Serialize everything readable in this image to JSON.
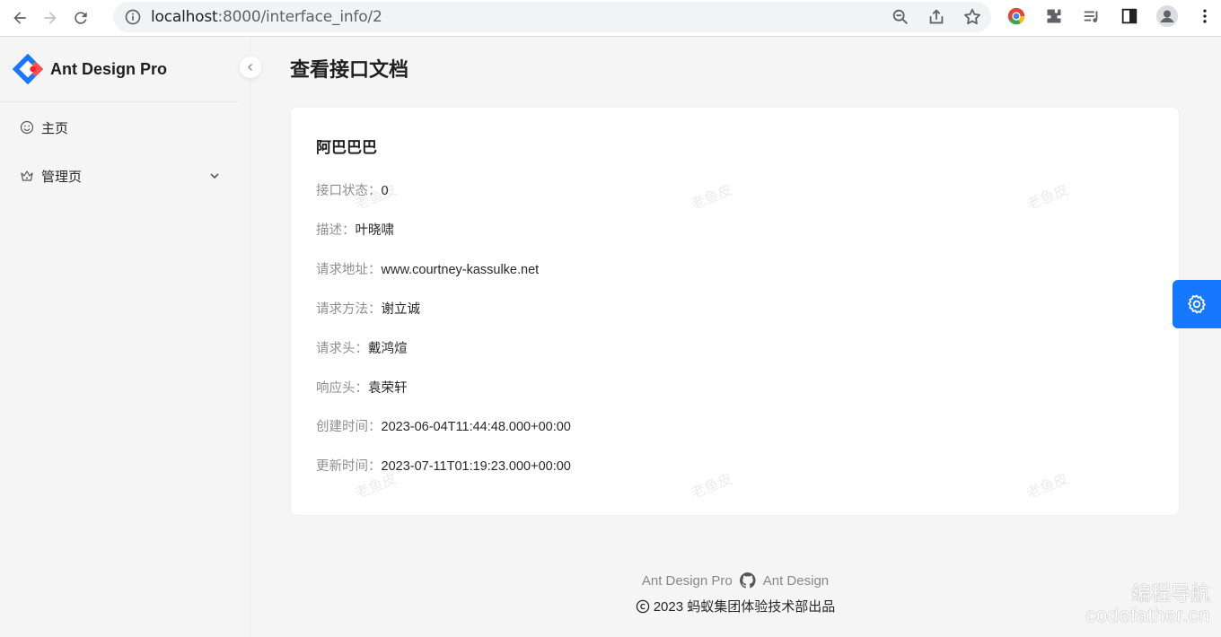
{
  "browser": {
    "url_host": "localhost",
    "url_path": ":8000/interface_info/2"
  },
  "sidebar": {
    "app_title": "Ant Design Pro",
    "items": [
      {
        "label": "主页",
        "icon": "smile-icon"
      },
      {
        "label": "管理页",
        "icon": "crown-icon"
      }
    ]
  },
  "page": {
    "title": "查看接口文档"
  },
  "card": {
    "name": "阿巴巴巴",
    "fields": [
      {
        "label": "接口状态：",
        "value": "0"
      },
      {
        "label": "描述：",
        "value": "叶晓啸"
      },
      {
        "label": "请求地址：",
        "value": "www.courtney-kassulke.net"
      },
      {
        "label": "请求方法：",
        "value": "谢立诚"
      },
      {
        "label": "请求头：",
        "value": "戴鸿煊"
      },
      {
        "label": "响应头：",
        "value": "袁荣轩"
      },
      {
        "label": "创建时间：",
        "value": "2023-06-04T11:44:48.000+00:00"
      },
      {
        "label": "更新时间：",
        "value": "2023-07-11T01:19:23.000+00:00"
      }
    ],
    "watermark": "老鱼皮"
  },
  "footer": {
    "link1": "Ant Design Pro",
    "link2": "Ant Design",
    "copyright": "2023 蚂蚁集团体验技术部出品"
  },
  "overlay": {
    "line1": "编程导航",
    "line2": "codefather.cn"
  },
  "colors": {
    "primary": "#1677ff"
  }
}
